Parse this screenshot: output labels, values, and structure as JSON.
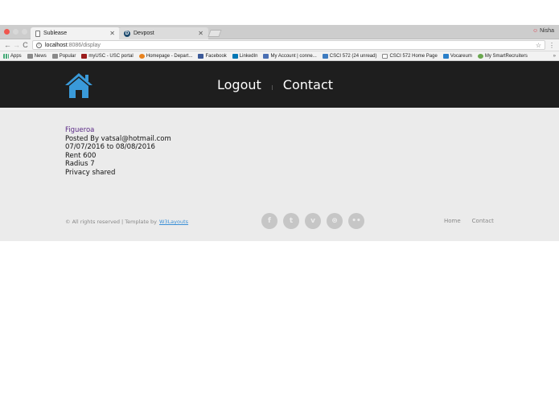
{
  "browser": {
    "tabs": [
      {
        "title": "Sublease",
        "active": true,
        "icon": "document-icon"
      },
      {
        "title": "Devpost",
        "active": false,
        "icon": "devpost-icon"
      }
    ],
    "profile_name": "Nisha",
    "url_host": "localhost",
    "url_path": ":8086/display",
    "bookmarks": [
      {
        "label": "Apps",
        "icon": "apps-grid-icon"
      },
      {
        "label": "News",
        "icon": "folder-icon"
      },
      {
        "label": "Popular",
        "icon": "folder-icon"
      },
      {
        "label": "myUSC - USC portal",
        "icon": "usc-icon"
      },
      {
        "label": "Homepage - Depart...",
        "icon": "homepage-icon"
      },
      {
        "label": "Facebook",
        "icon": "facebook-icon"
      },
      {
        "label": "LinkedIn",
        "icon": "linkedin-icon"
      },
      {
        "label": "My Account | conne...",
        "icon": "account-icon"
      },
      {
        "label": "CSCI 572 (24 unread)",
        "icon": "piazza-icon"
      },
      {
        "label": "CSCI 572 Home Page",
        "icon": "document-icon"
      },
      {
        "label": "Vocareum",
        "icon": "vocareum-icon"
      },
      {
        "label": "My SmartRecruiters",
        "icon": "smartrecruiters-icon"
      }
    ],
    "bookmarks_more": "»"
  },
  "header": {
    "logo_icon": "house-icon",
    "nav": [
      {
        "label": "Logout"
      },
      {
        "label": "Contact"
      }
    ]
  },
  "listing": {
    "location": "Figueroa",
    "posted_by": "Posted By vatsal@hotmail.com",
    "dates": "07/07/2016 to 08/08/2016",
    "rent": "Rent 600",
    "radius": "Radius 7",
    "privacy": "Privacy shared"
  },
  "footer": {
    "copyright": "© All rights reserved | Template by",
    "template_link": "W3Layouts",
    "socials": [
      {
        "glyph": "f",
        "icon": "facebook-icon"
      },
      {
        "glyph": "t",
        "icon": "twitter-icon"
      },
      {
        "glyph": "v",
        "icon": "vimeo-icon"
      },
      {
        "glyph": "⊛",
        "icon": "dribbble-icon"
      },
      {
        "glyph": "••",
        "icon": "flickr-icon"
      }
    ],
    "nav": [
      {
        "label": "Home"
      },
      {
        "label": "Contact"
      }
    ]
  },
  "colors": {
    "header_bg": "#1e1e1e",
    "content_bg": "#ebebeb",
    "logo_blue": "#3a9ad9",
    "link_purple": "#5b2a86",
    "link_blue": "#3a8fd6"
  }
}
